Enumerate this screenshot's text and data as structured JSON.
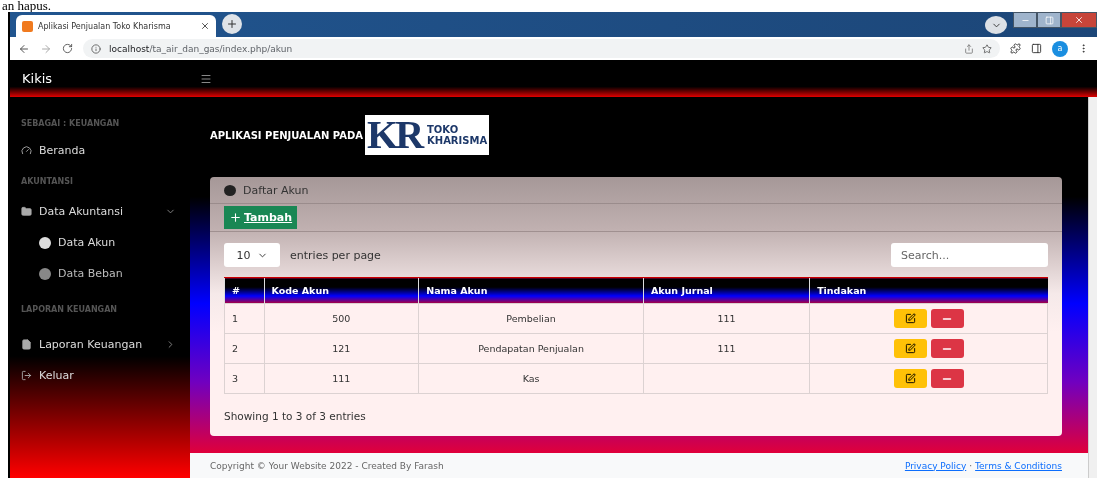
{
  "document_fragment": "an hapus.",
  "browser": {
    "tab_title": "Aplikasi Penjualan Toko Kharisma",
    "url_host": "localhost",
    "url_path": "/ta_air_dan_gas/index.php/akun",
    "profile": "a"
  },
  "navbar": {
    "brand": "Kikis"
  },
  "sidebar": {
    "role": "SEBAGAI : KEUANGAN",
    "home": "Beranda",
    "sections": [
      {
        "heading": "AKUNTANSI",
        "group": {
          "label": "Data Akuntansi",
          "expanded": true,
          "children": [
            {
              "label": "Data Akun",
              "selected": true
            },
            {
              "label": "Data Beban",
              "selected": false
            }
          ]
        }
      },
      {
        "heading": "LAPORAN KEUANGAN",
        "group": {
          "label": "Laporan Keuangan",
          "expanded": false
        }
      }
    ],
    "logout": "Keluar"
  },
  "header": {
    "title": "APLIKASI PENJUALAN PADA",
    "logo_letters": "KR",
    "logo_line_1": "TOKO",
    "logo_line_2": "KHARISMA"
  },
  "card": {
    "title": "Daftar Akun",
    "add_button": "Tambah",
    "page_size": "10",
    "entries_label": "entries per page",
    "search_placeholder": "Search...",
    "columns": [
      "#",
      "Kode Akun",
      "Nama Akun",
      "Akun Jurnal",
      "Tindakan"
    ],
    "rows": [
      {
        "cells": [
          "1",
          "500",
          "Pembelian",
          "111"
        ]
      },
      {
        "cells": [
          "2",
          "121",
          "Pendapatan Penjualan",
          "111"
        ]
      },
      {
        "cells": [
          "3",
          "111",
          "Kas",
          ""
        ]
      }
    ],
    "summary": "Showing 1 to 3 of 3 entries"
  },
  "footer": {
    "copyright": "Copyright © Your Website 2022 - Created By Farash",
    "links": [
      "Privacy Policy",
      "Terms & Conditions"
    ],
    "separator": "·"
  }
}
